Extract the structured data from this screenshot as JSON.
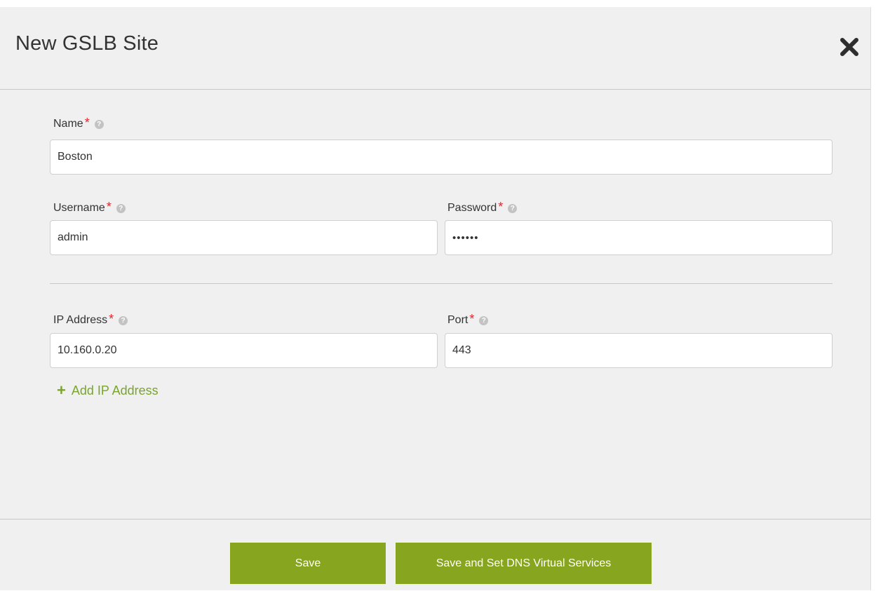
{
  "modal": {
    "title": "New GSLB Site",
    "close_icon": "close-icon"
  },
  "fields": {
    "name": {
      "label": "Name",
      "required_mark": "*",
      "value": "Boston"
    },
    "username": {
      "label": "Username",
      "required_mark": "*",
      "value": "admin"
    },
    "password": {
      "label": "Password",
      "required_mark": "*",
      "value": "••••••"
    },
    "ip_address": {
      "label": "IP Address",
      "required_mark": "*",
      "value": "10.160.0.20"
    },
    "port": {
      "label": "Port",
      "required_mark": "*",
      "value": "443"
    }
  },
  "help_icon": "help-icon",
  "add_ip": {
    "icon": "plus-icon",
    "label": "Add IP Address"
  },
  "footer": {
    "save_label": "Save",
    "save_dns_label": "Save and Set DNS Virtual Services"
  },
  "colors": {
    "accent_green": "#87a51f",
    "link_green": "#79a52a",
    "required_red": "#e0242c",
    "modal_bg": "#f0f0f0"
  }
}
